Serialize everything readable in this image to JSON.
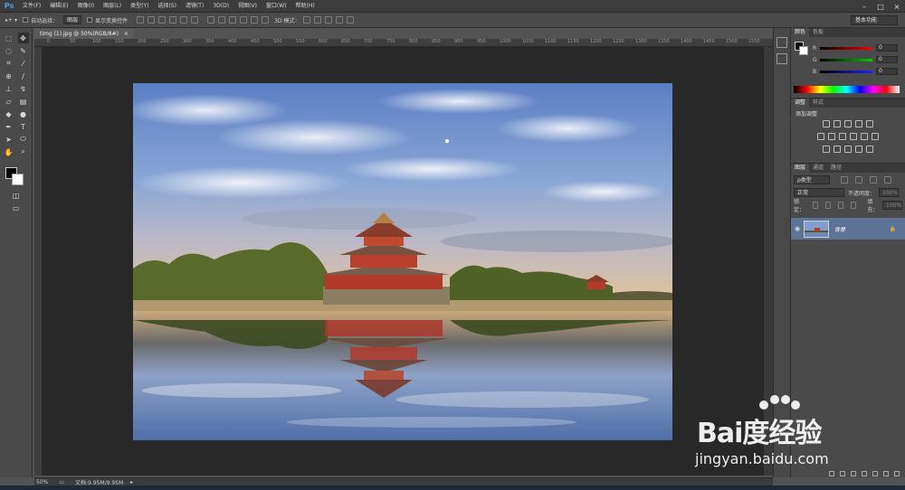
{
  "app": {
    "logo": "Ps"
  },
  "menu": [
    "文件(F)",
    "编辑(E)",
    "图像(I)",
    "图层(L)",
    "类型(Y)",
    "选择(S)",
    "滤镜(T)",
    "3D(D)",
    "视图(V)",
    "窗口(W)",
    "帮助(H)"
  ],
  "options": {
    "auto_select_label": "自动选择：",
    "auto_select_target": "图层",
    "show_transform_label": "显示变换控件",
    "mode_3d_label": "3D 模式：",
    "workspace": "基本功能"
  },
  "document": {
    "tab_title": "timg (1).jpg @ 50%(RGB/8#)",
    "tab_close": "×",
    "zoom": "50%",
    "doc_size": "文档:9.95M/9.95M"
  },
  "ruler_marks": [
    "0",
    "50",
    "100",
    "150",
    "200",
    "250",
    "300",
    "350",
    "400",
    "450",
    "500",
    "550",
    "600",
    "650",
    "700",
    "750",
    "800",
    "850",
    "900",
    "950",
    "1000",
    "1050",
    "1100",
    "1150",
    "1200",
    "1250",
    "1300",
    "1350",
    "1400",
    "1450",
    "1500",
    "1550"
  ],
  "color_panel": {
    "tabs": [
      "颜色",
      "色板"
    ],
    "r": {
      "label": "R",
      "value": "0"
    },
    "g": {
      "label": "G",
      "value": "0"
    },
    "b": {
      "label": "B",
      "value": "0"
    },
    "foreground": "#000000",
    "background": "#ffffff"
  },
  "adjustments_panel": {
    "tabs": [
      "调整",
      "样式"
    ],
    "title": "添加调整"
  },
  "layers_panel": {
    "tabs": [
      "图层",
      "通道",
      "路径"
    ],
    "filter": "ρ类型",
    "blend_mode": "正常",
    "opacity_label": "不透明度：",
    "opacity_value": "100%",
    "lock_label": "锁定：",
    "fill_label": "填充：",
    "fill_value": "100%",
    "layer": {
      "name": "背景",
      "lock": "🔒"
    }
  },
  "watermark": {
    "brand": "Bai度经验",
    "url": "jingyan.baidu.com"
  }
}
